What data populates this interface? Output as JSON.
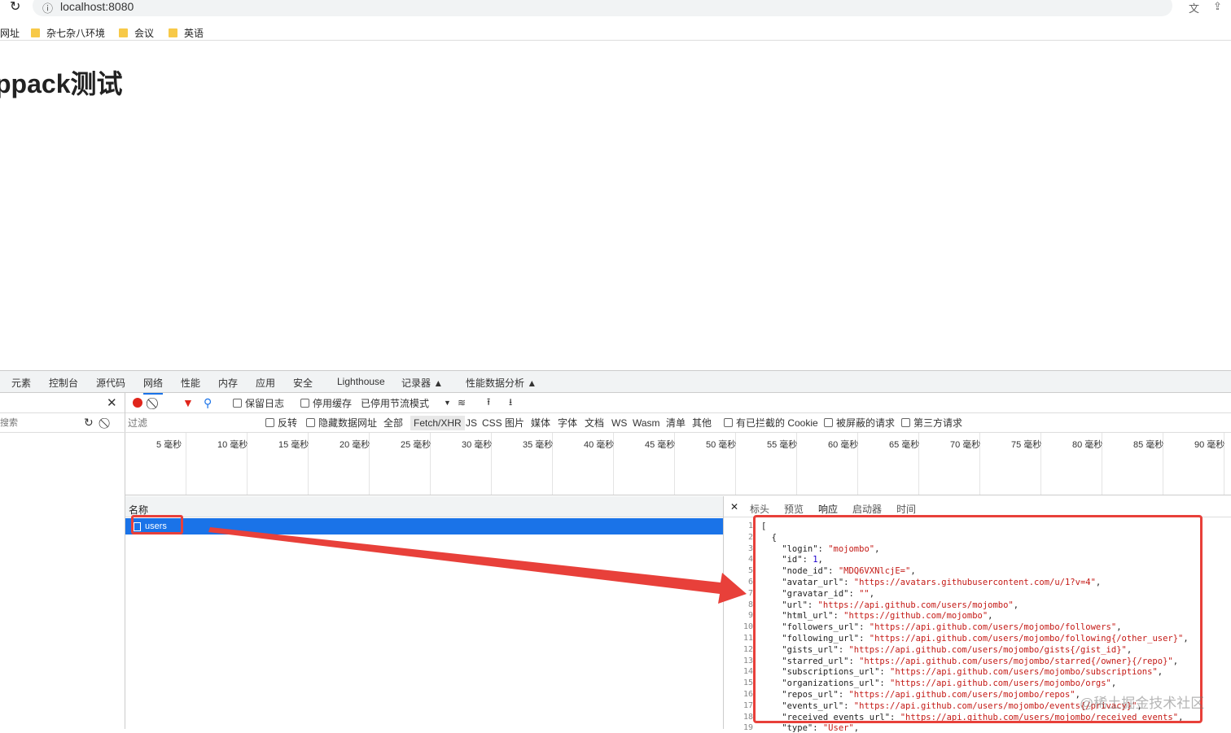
{
  "browser": {
    "url": "localhost:8080",
    "bookmarks": [
      "网址",
      "杂七杂八环境",
      "会议",
      "英语"
    ]
  },
  "page": {
    "heading": "ppack测试"
  },
  "devtools": {
    "tabs": [
      "元素",
      "控制台",
      "源代码",
      "网络",
      "性能",
      "内存",
      "应用",
      "安全",
      "Lighthouse",
      "记录器 ▲",
      "性能数据分析 ▲"
    ],
    "active_tab": "网络",
    "toolbar": {
      "preserve_log": "保留日志",
      "disable_cache": "停用缓存",
      "throttling": "已停用节流模式"
    },
    "search_placeholder": "搜索",
    "filter": {
      "placeholder": "过滤",
      "invert": "反转",
      "hide_data_urls": "隐藏数据网址",
      "types": [
        "全部",
        "Fetch/XHR",
        "JS",
        "CSS",
        "图片",
        "媒体",
        "字体",
        "文档",
        "WS",
        "Wasm",
        "清单",
        "其他"
      ],
      "active_type": "Fetch/XHR",
      "blocked_cookies": "有已拦截的 Cookie",
      "blocked_requests": "被屏蔽的请求",
      "third_party": "第三方请求"
    },
    "timeline_ticks": [
      "5 毫秒",
      "10 毫秒",
      "15 毫秒",
      "20 毫秒",
      "25 毫秒",
      "30 毫秒",
      "35 毫秒",
      "40 毫秒",
      "45 毫秒",
      "50 毫秒",
      "55 毫秒",
      "60 毫秒",
      "65 毫秒",
      "70 毫秒",
      "75 毫秒",
      "80 毫秒",
      "85 毫秒",
      "90 毫秒"
    ],
    "name_header": "名称",
    "requests": [
      {
        "name": "users",
        "selected": true
      }
    ],
    "detail_tabs": [
      "标头",
      "预览",
      "响应",
      "启动器",
      "时间"
    ],
    "active_detail_tab": "响应",
    "response_lines": [
      [
        "[",
        "",
        ""
      ],
      [
        "  {",
        "",
        ""
      ],
      [
        "    \"login\": ",
        "\"mojombo\"",
        ","
      ],
      [
        "    \"id\": ",
        "1",
        ","
      ],
      [
        "    \"node_id\": ",
        "\"MDQ6VXNlcjE=\"",
        ","
      ],
      [
        "    \"avatar_url\": ",
        "\"https://avatars.githubusercontent.com/u/1?v=4\"",
        ","
      ],
      [
        "    \"gravatar_id\": ",
        "\"\"",
        ","
      ],
      [
        "    \"url\": ",
        "\"https://api.github.com/users/mojombo\"",
        ","
      ],
      [
        "    \"html_url\": ",
        "\"https://github.com/mojombo\"",
        ","
      ],
      [
        "    \"followers_url\": ",
        "\"https://api.github.com/users/mojombo/followers\"",
        ","
      ],
      [
        "    \"following_url\": ",
        "\"https://api.github.com/users/mojombo/following{/other_user}\"",
        ","
      ],
      [
        "    \"gists_url\": ",
        "\"https://api.github.com/users/mojombo/gists{/gist_id}\"",
        ","
      ],
      [
        "    \"starred_url\": ",
        "\"https://api.github.com/users/mojombo/starred{/owner}{/repo}\"",
        ","
      ],
      [
        "    \"subscriptions_url\": ",
        "\"https://api.github.com/users/mojombo/subscriptions\"",
        ","
      ],
      [
        "    \"organizations_url\": ",
        "\"https://api.github.com/users/mojombo/orgs\"",
        ","
      ],
      [
        "    \"repos_url\": ",
        "\"https://api.github.com/users/mojombo/repos\"",
        ","
      ],
      [
        "    \"events_url\": ",
        "\"https://api.github.com/users/mojombo/events{/privacy}\"",
        ","
      ],
      [
        "    \"received_events_url\": ",
        "\"https://api.github.com/users/mojombo/received_events\"",
        ","
      ],
      [
        "    \"type\": ",
        "\"User\"",
        ","
      ]
    ]
  },
  "watermark": "@稀土掘金技术社区",
  "colors": {
    "accent": "#1a73e8",
    "annotation": "#e8403a",
    "selected_row": "#1a73e8"
  }
}
